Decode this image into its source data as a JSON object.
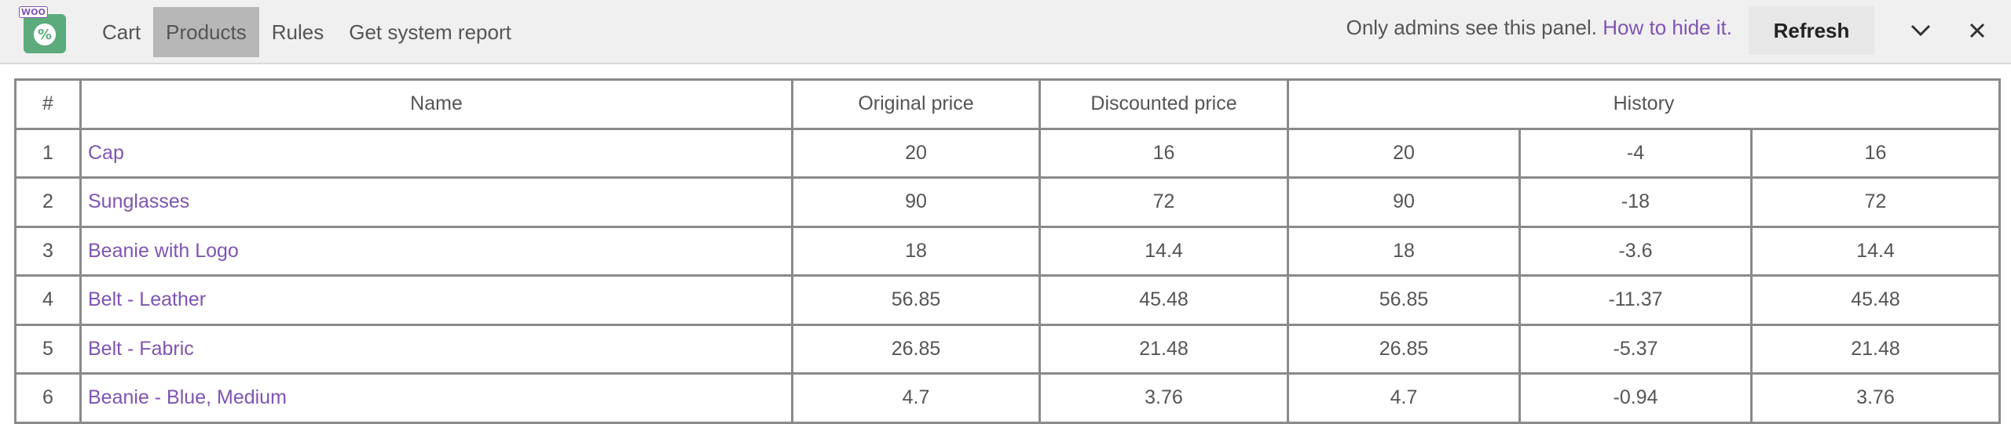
{
  "toolbar": {
    "tabs": [
      {
        "label": "Cart",
        "active": false
      },
      {
        "label": "Products",
        "active": true
      },
      {
        "label": "Rules",
        "active": false
      },
      {
        "label": "Get system report",
        "active": false
      }
    ],
    "admin_note": "Only admins see this panel.",
    "hide_link": "How to hide it.",
    "refresh_label": "Refresh",
    "logo_badge": "WOO"
  },
  "table": {
    "headers": [
      "#",
      "Name",
      "Original price",
      "Discounted price",
      "History"
    ],
    "rows": [
      {
        "num": "1",
        "name": "Cap",
        "original": "20",
        "discounted": "16",
        "history": [
          "20",
          "-4",
          "16"
        ]
      },
      {
        "num": "2",
        "name": "Sunglasses",
        "original": "90",
        "discounted": "72",
        "history": [
          "90",
          "-18",
          "72"
        ]
      },
      {
        "num": "3",
        "name": "Beanie with Logo",
        "original": "18",
        "discounted": "14.4",
        "history": [
          "18",
          "-3.6",
          "14.4"
        ]
      },
      {
        "num": "4",
        "name": "Belt - Leather",
        "original": "56.85",
        "discounted": "45.48",
        "history": [
          "56.85",
          "-11.37",
          "45.48"
        ]
      },
      {
        "num": "5",
        "name": "Belt - Fabric",
        "original": "26.85",
        "discounted": "21.48",
        "history": [
          "26.85",
          "-5.37",
          "21.48"
        ]
      },
      {
        "num": "6",
        "name": "Beanie - Blue, Medium",
        "original": "4.7",
        "discounted": "3.76",
        "history": [
          "4.7",
          "-0.94",
          "3.76"
        ]
      }
    ]
  },
  "colors": {
    "accent": "#7f54b3",
    "logo": "#5bab7c",
    "active_tab": "#b7b7b7"
  }
}
